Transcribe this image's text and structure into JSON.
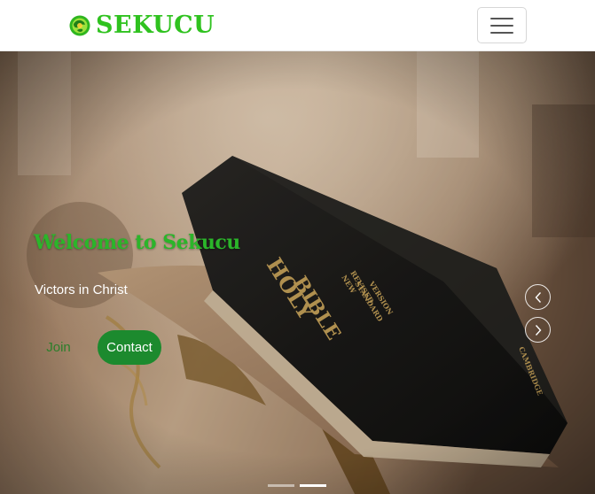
{
  "brand": {
    "name": "SEKUCU",
    "logo_icon": "globe-logo-icon",
    "color": "#2fc21f"
  },
  "navbar": {
    "toggler_icon": "hamburger-menu-icon"
  },
  "hero": {
    "image": "open-holy-bible-on-lectern",
    "book_spine_text": [
      "HOLY",
      "BIBLE",
      "NEW REVISED STANDARD VERSION",
      "CAMBRIDGE"
    ],
    "title": "Welcome to Sekucu",
    "subtitle": "Victors in Christ",
    "title_color": "#2bb52a",
    "buttons": {
      "join_label": "Join",
      "contact_label": "Contact",
      "join_text_color": "#2a7f2a",
      "contact_bg": "#1c8a2e",
      "contact_text_color": "#ffffff"
    },
    "controls": {
      "prev_icon": "chevron-left-icon",
      "next_icon": "chevron-right-icon"
    },
    "indicators": {
      "count": 2,
      "active_index": 1
    }
  }
}
